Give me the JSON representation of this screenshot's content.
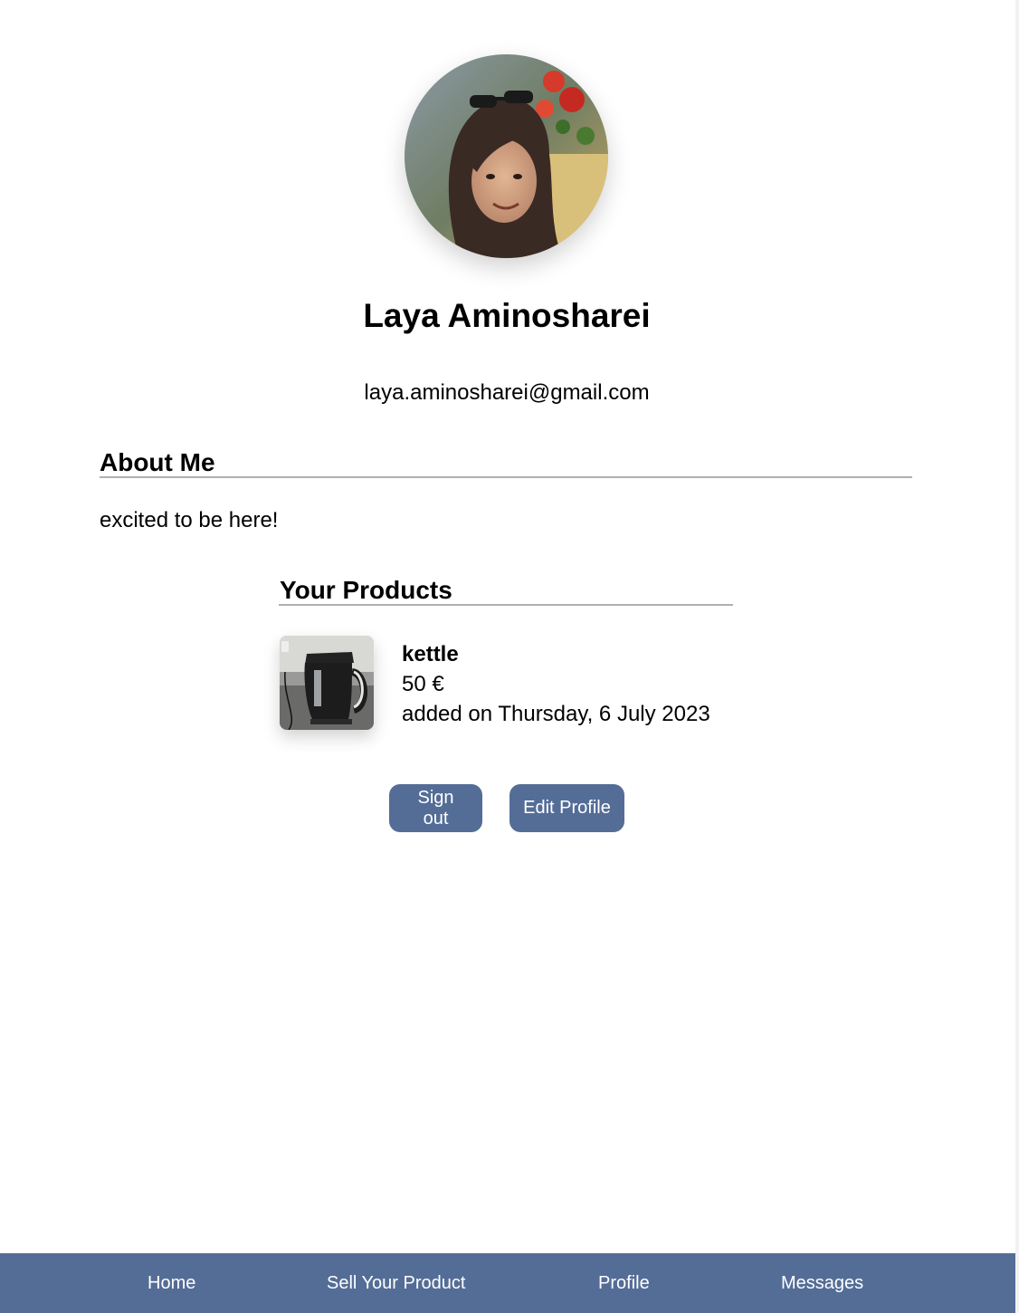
{
  "profile": {
    "avatar_icon": "user-photo",
    "name": "Laya Aminosharei",
    "email": "laya.aminosharei@gmail.com"
  },
  "about": {
    "heading": "About Me",
    "text": "excited to be here!"
  },
  "products": {
    "heading": "Your Products",
    "items": [
      {
        "thumbnail_icon": "kettle-photo",
        "title": "kettle",
        "price": "50 €",
        "date": "added on Thursday, 6 July 2023"
      }
    ]
  },
  "actions": {
    "sign_out_label": "Sign out",
    "edit_profile_label": "Edit Profile"
  },
  "nav": {
    "items": [
      {
        "label": "Home"
      },
      {
        "label": "Sell Your Product"
      },
      {
        "label": "Profile"
      },
      {
        "label": "Messages"
      }
    ]
  },
  "colors": {
    "accent": "#546d97",
    "background": "#ffffff",
    "text": "#000000",
    "rule": "#b0b0b0"
  }
}
